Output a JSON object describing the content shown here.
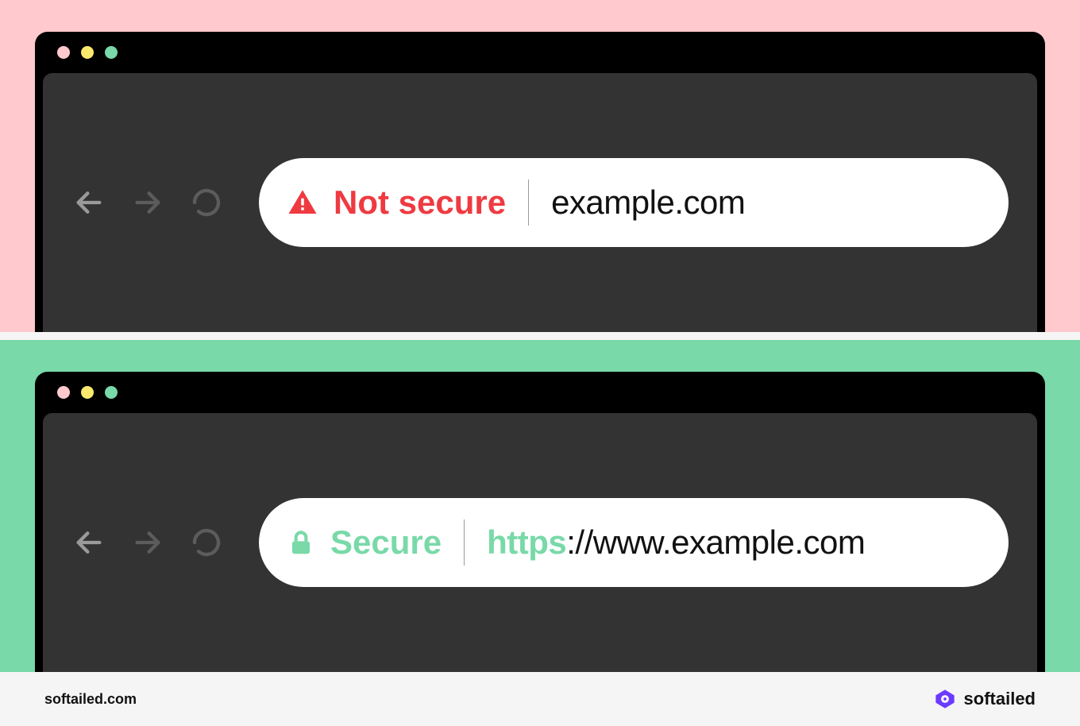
{
  "panels": {
    "insecure": {
      "security_label": "Not secure",
      "security_icon": "alert-triangle-icon",
      "url": "example.com",
      "bg_color": "#ffc9cd",
      "label_color": "#ef3a41"
    },
    "secure": {
      "security_label": "Secure",
      "security_icon": "lock-icon",
      "url_scheme": "https",
      "url_rest": "://www.example.com",
      "bg_color": "#79d9a8",
      "label_color": "#79d9a8"
    }
  },
  "traffic_lights": [
    "#ffc9cd",
    "#f9e96c",
    "#79d9a8"
  ],
  "footer": {
    "site": "softailed.com",
    "brand": "softailed",
    "brand_color": "#6b3bff"
  }
}
